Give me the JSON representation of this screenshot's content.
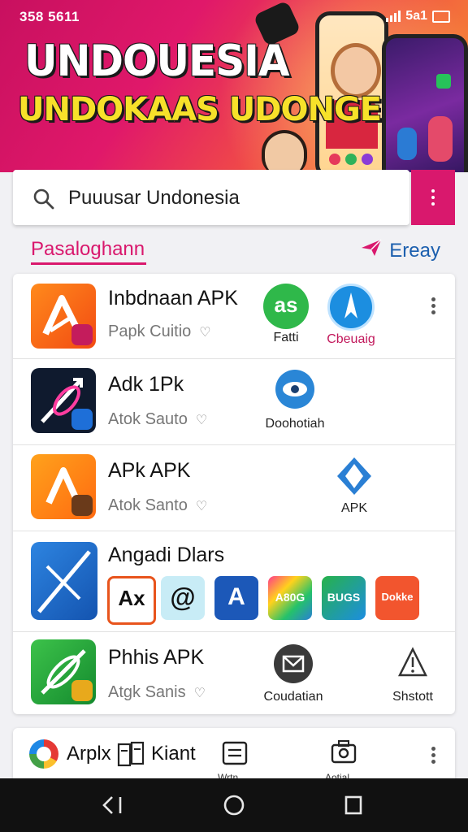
{
  "status": {
    "time": "358 5611",
    "right_text": "5a1"
  },
  "banner": {
    "line1": "UNDOUESIA",
    "line2": "UNDOKAAS UDONGE"
  },
  "search": {
    "text": "Puuusar  Undonesia"
  },
  "section": {
    "left_label": "Pasaloghann",
    "right_label": "Ereay"
  },
  "apps": [
    {
      "title": "Inbdnaan APK",
      "subtitle": "Papk Cuitio",
      "extras": [
        {
          "label": "Fatti",
          "icon": "as-green-icon",
          "glyph": "as"
        },
        {
          "label": "Cbeuaig",
          "icon": "compass-app-icon"
        }
      ]
    },
    {
      "title": "Adk 1Pk",
      "subtitle": "Atok Sauto",
      "extras": [
        {
          "label": "Doohotiah",
          "icon": "eye-app-icon"
        }
      ]
    },
    {
      "title": "APk APK",
      "subtitle": "Atok Santo",
      "extras": [
        {
          "label": "APK",
          "icon": "apk-diamond-icon"
        }
      ]
    },
    {
      "title": "Angadi Dlars",
      "subtitle": "",
      "tiles": [
        {
          "icon": "tile-ax-icon",
          "glyph": "Ax"
        },
        {
          "icon": "tile-swirl-icon",
          "glyph": "@"
        },
        {
          "icon": "tile-star-icon",
          "glyph": "A"
        },
        {
          "icon": "tile-rainbow-icon",
          "glyph": "A80G"
        },
        {
          "icon": "tile-bung-icon",
          "glyph": "BUGS"
        },
        {
          "icon": "tile-red-icon",
          "glyph": "Dokke"
        }
      ]
    },
    {
      "title": "Phhis APK",
      "subtitle": "Atgk Sanis",
      "extras": [
        {
          "label": "Coudatian",
          "icon": "mail-app-icon"
        },
        {
          "label": "Shstott",
          "icon": "alert-app-icon"
        }
      ]
    }
  ],
  "bottom": {
    "label1": "Arplx",
    "label2": "Kiant",
    "label3": "Wrtn",
    "label4": "Aotial"
  },
  "colors": {
    "accent": "#d9186d",
    "blue": "#1c5fae"
  }
}
